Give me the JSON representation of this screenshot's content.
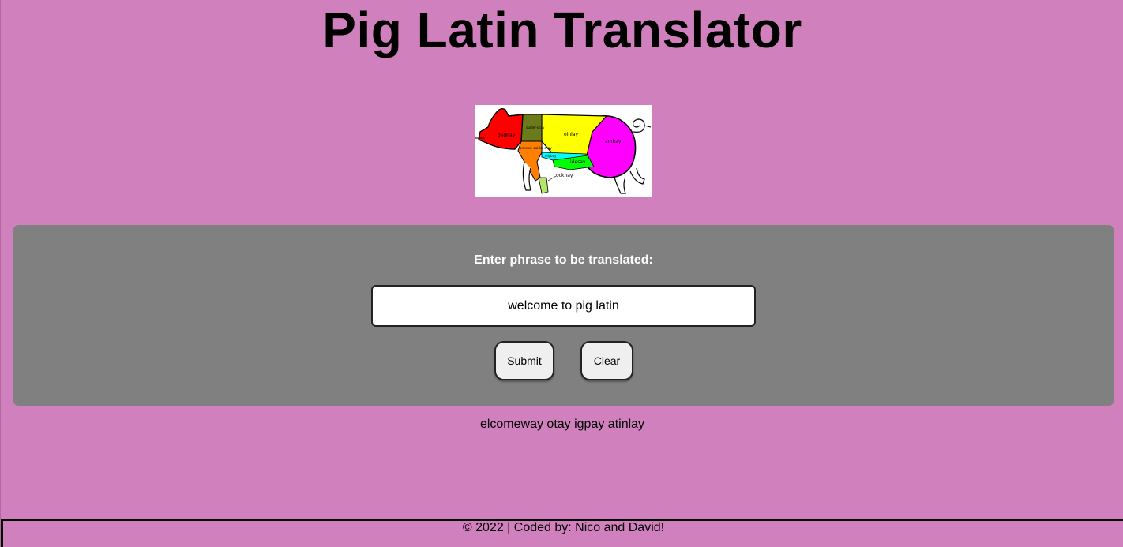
{
  "header": {
    "title": "Pig Latin Translator"
  },
  "image": {
    "alt": "Pig diagram with cuts labeled in pig latin",
    "labels": {
      "head": "oadhay",
      "shoulder_top": "oulder-shay",
      "shoulder_prefix": "oulder",
      "loin": "oinlay",
      "ham": "amhay",
      "arm": "armway oulder-shay",
      "belly": "ellybay",
      "side": "idesay",
      "hock": "ockhay"
    }
  },
  "form": {
    "prompt": "Enter phrase to be translated:",
    "input_value": "welcome to pig latin",
    "submit_label": "Submit",
    "clear_label": "Clear"
  },
  "result": {
    "text": "elcomeway otay igpay atinlay"
  },
  "footer": {
    "text": "© 2022 | Coded by: Nico and David!"
  },
  "colors": {
    "background": "#d081bd",
    "panel": "#808080",
    "head_cut": "#ff0000",
    "shoulder_cut": "#6b7a1a",
    "loin_cut": "#ffff00",
    "ham_cut": "#ff00ff",
    "arm_cut": "#ff8000",
    "belly_cut": "#00ffff",
    "side_cut": "#00ff00",
    "hock_cut": "#b6e36a"
  }
}
